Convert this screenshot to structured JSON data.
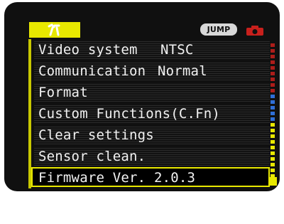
{
  "header": {
    "active_tab_icon": "wrench-hammer-icon",
    "jump_label": "JUMP",
    "camera_tab_icon": "camera-icon",
    "colors": {
      "tab_yellow": "#e8e800",
      "camera_red": "#c8201c",
      "scroll_blue": "#2f6fd8"
    }
  },
  "menu": {
    "items": [
      {
        "label": "Video system",
        "value": "NTSC"
      },
      {
        "label": "Communication",
        "value": "Normal"
      },
      {
        "label": "Format",
        "value": ""
      },
      {
        "label": "Custom Functions(C.Fn)",
        "value": ""
      },
      {
        "label": "Clear settings",
        "value": ""
      },
      {
        "label": "Sensor clean.",
        "value": ""
      },
      {
        "label": "Firmware Ver. 2.0.3",
        "value": ""
      }
    ],
    "selected_index": 6
  }
}
